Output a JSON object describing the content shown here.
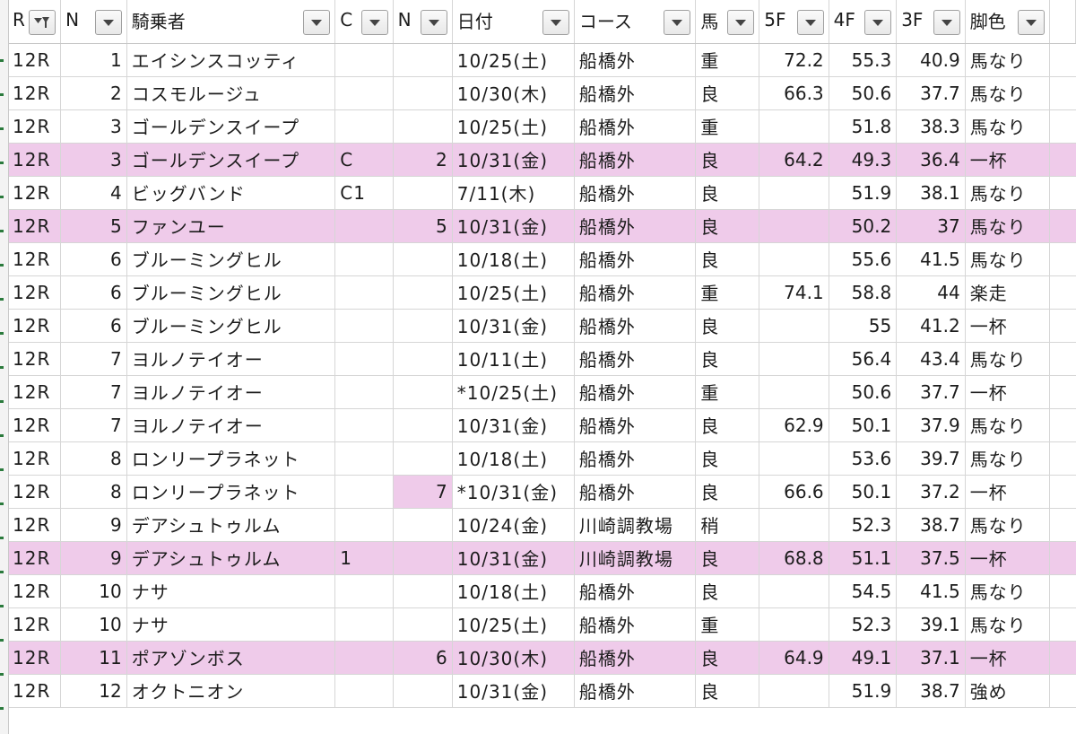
{
  "columns": [
    {
      "key": "r",
      "label": "R",
      "align": "left",
      "filter": "funnel-filter-icon"
    },
    {
      "key": "n",
      "label": "N",
      "align": "right",
      "filter": "dropdown-arrow-icon"
    },
    {
      "key": "rider",
      "label": "騎乗者",
      "align": "left",
      "filter": "dropdown-arrow-icon"
    },
    {
      "key": "c",
      "label": "C",
      "align": "left",
      "filter": "dropdown-arrow-icon"
    },
    {
      "key": "n2",
      "label": "N",
      "align": "right",
      "filter": "dropdown-arrow-icon"
    },
    {
      "key": "date",
      "label": "日付",
      "align": "left",
      "filter": "dropdown-arrow-icon"
    },
    {
      "key": "course",
      "label": "コース",
      "align": "left",
      "filter": "dropdown-arrow-icon"
    },
    {
      "key": "horse",
      "label": "馬",
      "align": "left",
      "filter": "dropdown-arrow-icon"
    },
    {
      "key": "f5",
      "label": "5F",
      "align": "right",
      "filter": "dropdown-arrow-icon"
    },
    {
      "key": "f4",
      "label": "4F",
      "align": "right",
      "filter": "dropdown-arrow-icon"
    },
    {
      "key": "f3",
      "label": "3F",
      "align": "right",
      "filter": "dropdown-arrow-icon"
    },
    {
      "key": "leg",
      "label": "脚色",
      "align": "left",
      "filter": "dropdown-arrow-icon"
    },
    {
      "key": "x",
      "label": "",
      "align": "left",
      "filter": ""
    }
  ],
  "rows": [
    {
      "r": "12R",
      "n": "1",
      "rider": "エイシンスコッティ",
      "c": "",
      "n2": "",
      "date": "10/25(土)",
      "course": "船橋外",
      "horse": "重",
      "f5": "72.2",
      "f4": "55.3",
      "f3": "40.9",
      "leg": "馬なり",
      "x": "",
      "highlight": false
    },
    {
      "r": "12R",
      "n": "2",
      "rider": "コスモルージュ",
      "c": "",
      "n2": "",
      "date": "10/30(木)",
      "course": "船橋外",
      "horse": "良",
      "f5": "66.3",
      "f4": "50.6",
      "f3": "37.7",
      "leg": "馬なり",
      "x": "",
      "highlight": false
    },
    {
      "r": "12R",
      "n": "3",
      "rider": "ゴールデンスイープ",
      "c": "",
      "n2": "",
      "date": "10/25(土)",
      "course": "船橋外",
      "horse": "重",
      "f5": "",
      "f4": "51.8",
      "f3": "38.3",
      "leg": "馬なり",
      "x": "",
      "highlight": false
    },
    {
      "r": "12R",
      "n": "3",
      "rider": "ゴールデンスイープ",
      "c": "C",
      "n2": "2",
      "date": "10/31(金)",
      "course": "船橋外",
      "horse": "良",
      "f5": "64.2",
      "f4": "49.3",
      "f3": "36.4",
      "leg": "一杯",
      "x": "",
      "highlight": true
    },
    {
      "r": "12R",
      "n": "4",
      "rider": "ビッグバンド",
      "c": "C1",
      "n2": "",
      "date": "7/11(木)",
      "course": "船橋外",
      "horse": "良",
      "f5": "",
      "f4": "51.9",
      "f3": "38.1",
      "leg": "馬なり",
      "x": "",
      "highlight": false
    },
    {
      "r": "12R",
      "n": "5",
      "rider": "ファンユー",
      "c": "",
      "n2": "5",
      "date": "10/31(金)",
      "course": "船橋外",
      "horse": "良",
      "f5": "",
      "f4": "50.2",
      "f3": "37",
      "leg": "馬なり",
      "x": "",
      "highlight": true
    },
    {
      "r": "12R",
      "n": "6",
      "rider": "ブルーミングヒル",
      "c": "",
      "n2": "",
      "date": "10/18(土)",
      "course": "船橋外",
      "horse": "良",
      "f5": "",
      "f4": "55.6",
      "f3": "41.5",
      "leg": "馬なり",
      "x": "",
      "highlight": false
    },
    {
      "r": "12R",
      "n": "6",
      "rider": "ブルーミングヒル",
      "c": "",
      "n2": "",
      "date": "10/25(土)",
      "course": "船橋外",
      "horse": "重",
      "f5": "74.1",
      "f4": "58.8",
      "f3": "44",
      "leg": "楽走",
      "x": "",
      "highlight": false
    },
    {
      "r": "12R",
      "n": "6",
      "rider": "ブルーミングヒル",
      "c": "",
      "n2": "",
      "date": "10/31(金)",
      "course": "船橋外",
      "horse": "良",
      "f5": "",
      "f4": "55",
      "f3": "41.2",
      "leg": "一杯",
      "x": "",
      "highlight": false
    },
    {
      "r": "12R",
      "n": "7",
      "rider": "ヨルノテイオー",
      "c": "",
      "n2": "",
      "date": "10/11(土)",
      "course": "船橋外",
      "horse": "良",
      "f5": "",
      "f4": "56.4",
      "f3": "43.4",
      "leg": "馬なり",
      "x": "",
      "highlight": false
    },
    {
      "r": "12R",
      "n": "7",
      "rider": "ヨルノテイオー",
      "c": "",
      "n2": "",
      "date": "*10/25(土)",
      "course": "船橋外",
      "horse": "重",
      "f5": "",
      "f4": "50.6",
      "f3": "37.7",
      "leg": "一杯",
      "x": "",
      "highlight": false
    },
    {
      "r": "12R",
      "n": "7",
      "rider": "ヨルノテイオー",
      "c": "",
      "n2": "",
      "date": "10/31(金)",
      "course": "船橋外",
      "horse": "良",
      "f5": "62.9",
      "f4": "50.1",
      "f3": "37.9",
      "leg": "馬なり",
      "x": "",
      "highlight": false
    },
    {
      "r": "12R",
      "n": "8",
      "rider": "ロンリープラネット",
      "c": "",
      "n2": "",
      "date": "10/18(土)",
      "course": "船橋外",
      "horse": "良",
      "f5": "",
      "f4": "53.6",
      "f3": "39.7",
      "leg": "馬なり",
      "x": "",
      "highlight": false
    },
    {
      "r": "12R",
      "n": "8",
      "rider": "ロンリープラネット",
      "c": "",
      "n2": "7",
      "date": "*10/31(金)",
      "course": "船橋外",
      "horse": "良",
      "f5": "66.6",
      "f4": "50.1",
      "f3": "37.2",
      "leg": "一杯",
      "x": "",
      "highlight": false,
      "cell_highlight": [
        "n2"
      ]
    },
    {
      "r": "12R",
      "n": "9",
      "rider": "デアシュトゥルム",
      "c": "",
      "n2": "",
      "date": "10/24(金)",
      "course": "川崎調教場",
      "horse": "稍",
      "f5": "",
      "f4": "52.3",
      "f3": "38.7",
      "leg": "馬なり",
      "x": "",
      "highlight": false
    },
    {
      "r": "12R",
      "n": "9",
      "rider": "デアシュトゥルム",
      "c": "1",
      "n2": "",
      "date": "10/31(金)",
      "course": "川崎調教場",
      "horse": "良",
      "f5": "68.8",
      "f4": "51.1",
      "f3": "37.5",
      "leg": "一杯",
      "x": "",
      "highlight": true
    },
    {
      "r": "12R",
      "n": "10",
      "rider": "ナサ",
      "c": "",
      "n2": "",
      "date": "10/18(土)",
      "course": "船橋外",
      "horse": "良",
      "f5": "",
      "f4": "54.5",
      "f3": "41.5",
      "leg": "馬なり",
      "x": "",
      "highlight": false
    },
    {
      "r": "12R",
      "n": "10",
      "rider": "ナサ",
      "c": "",
      "n2": "",
      "date": "10/25(土)",
      "course": "船橋外",
      "horse": "重",
      "f5": "",
      "f4": "52.3",
      "f3": "39.1",
      "leg": "馬なり",
      "x": "",
      "highlight": false
    },
    {
      "r": "12R",
      "n": "11",
      "rider": "ポアゾンボス",
      "c": "",
      "n2": "6",
      "date": "10/30(木)",
      "course": "船橋外",
      "horse": "良",
      "f5": "64.9",
      "f4": "49.1",
      "f3": "37.1",
      "leg": "一杯",
      "x": "",
      "highlight": true
    },
    {
      "r": "12R",
      "n": "12",
      "rider": "オクトニオン",
      "c": "",
      "n2": "",
      "date": "10/31(金)",
      "course": "船橋外",
      "horse": "良",
      "f5": "",
      "f4": "51.9",
      "f3": "38.7",
      "leg": "強め",
      "x": "",
      "highlight": false
    }
  ],
  "colors": {
    "highlight": "#efcbea",
    "grid": "#d6d6d6",
    "row_marker": "#2a7a3c"
  }
}
